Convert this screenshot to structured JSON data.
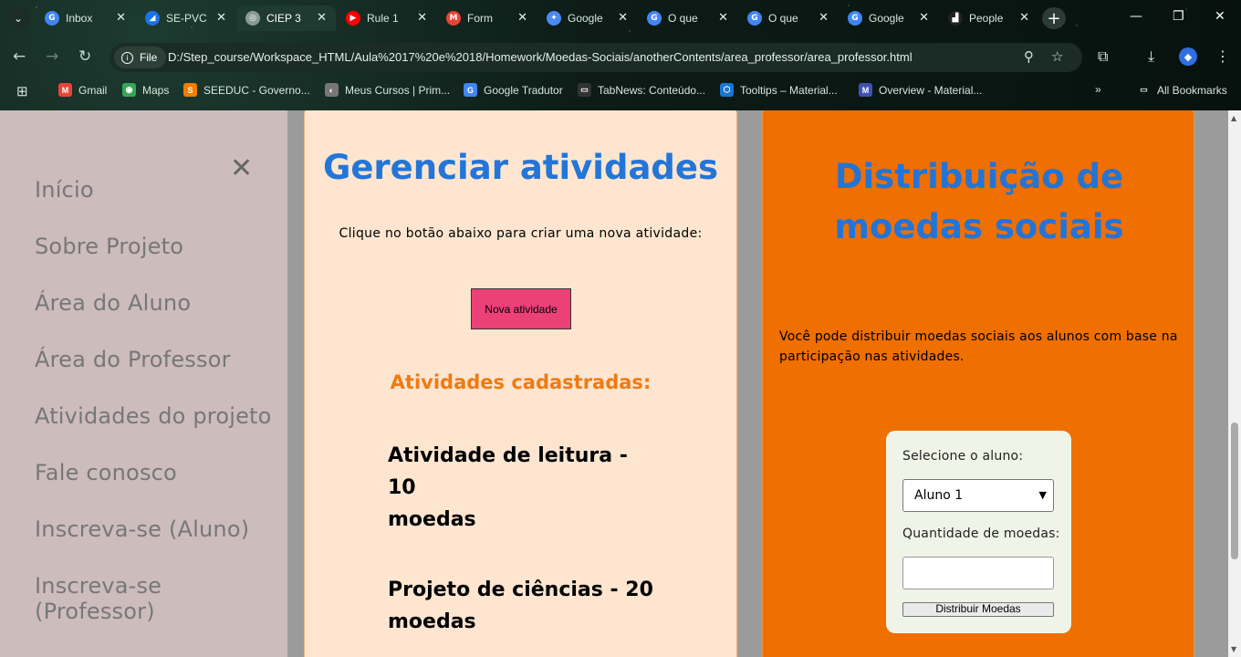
{
  "browser": {
    "tabs": [
      {
        "title": "Inbox",
        "favicon": "G",
        "color": "#4285f4",
        "active": false
      },
      {
        "title": "SE-PVC",
        "favicon": "◢",
        "color": "#1a73e8",
        "active": false
      },
      {
        "title": "CIEP 3",
        "favicon": "◎",
        "color": "#8a9a94",
        "active": true
      },
      {
        "title": "Rule 1",
        "favicon": "▶",
        "color": "#ff0000",
        "active": false
      },
      {
        "title": "Form",
        "favicon": "M",
        "color": "#ea4335",
        "active": false
      },
      {
        "title": "Google",
        "favicon": "✦",
        "color": "#4a8af4",
        "active": false
      },
      {
        "title": "O que",
        "favicon": "G",
        "color": "#4285f4",
        "active": false
      },
      {
        "title": "O que",
        "favicon": "G",
        "color": "#4285f4",
        "active": false
      },
      {
        "title": "Google",
        "favicon": "G",
        "color": "#4285f4",
        "active": false
      },
      {
        "title": "People",
        "favicon": "▟",
        "color": "#222222",
        "active": false
      }
    ],
    "url": "D:/Step_course/Workspace_HTML/Aula%2017%20e%2018/Homework/Moedas-Sociais/anotherContents/area_professor/area_professor.html",
    "file_chip": "File",
    "bookmarks": [
      {
        "label": "Gmail",
        "icon": "M",
        "color": "#ea4335"
      },
      {
        "label": "Maps",
        "icon": "◉",
        "color": "#34a853"
      },
      {
        "label": "SEEDUC - Governo...",
        "icon": "S",
        "color": "#f57c00"
      },
      {
        "label": "Meus Cursos | Prim...",
        "icon": "◐",
        "color": "#777777"
      },
      {
        "label": "Google Tradutor",
        "icon": "G",
        "color": "#4285f4"
      },
      {
        "label": "TabNews: Conteúdo...",
        "icon": "▭",
        "color": "#333333"
      },
      {
        "label": "Tooltips – Material...",
        "icon": "⬡",
        "color": "#1976d2"
      },
      {
        "label": "Overview - Material...",
        "icon": "M",
        "color": "#3f51b5"
      }
    ],
    "all_bookmarks": "All Bookmarks"
  },
  "sidebar": {
    "items": [
      {
        "label": "Início"
      },
      {
        "label": "Sobre Projeto"
      },
      {
        "label": "Área do Aluno"
      },
      {
        "label": "Área do Professor"
      },
      {
        "label": "Atividades do projeto"
      },
      {
        "label": "Fale conosco"
      },
      {
        "label": "Inscreva-se (Aluno)"
      },
      {
        "label": "Inscreva-se (Professor)"
      }
    ]
  },
  "manage": {
    "title": "Gerenciar atividades",
    "hint": "Clique no botão abaixo para criar uma nova atividade:",
    "button": "Nova atividade",
    "registered_title": "Atividades cadastradas:",
    "activities": [
      {
        "line1": "Atividade de leitura - 10",
        "line2": "moedas"
      },
      {
        "line1": "Projeto de ciências - 20",
        "line2": "moedas"
      }
    ]
  },
  "distribution": {
    "title_line1": "Distribuição de",
    "title_line2": "moedas sociais",
    "description_line1": "Você pode distribuir moedas sociais aos alunos com base na",
    "description_line2": "participação nas atividades.",
    "select_label": "Selecione o aluno:",
    "selected_student": "Aluno 1",
    "quantity_label": "Quantidade de moedas:",
    "quantity_value": "",
    "submit": "Distribuir Moedas"
  }
}
